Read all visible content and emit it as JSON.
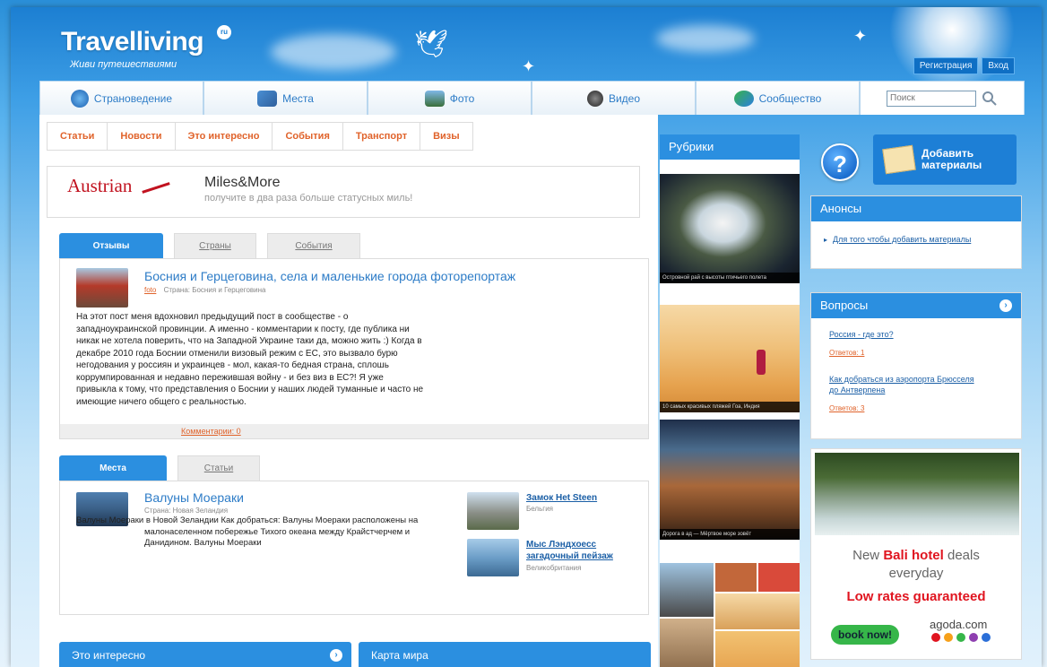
{
  "header": {
    "logo_title": "Travelliving",
    "logo_badge": "ru",
    "logo_subtitle": "Живи путешествиями",
    "register": "Регистрация",
    "login": "Вход"
  },
  "nav": {
    "tabs": [
      {
        "label": "Страноведение",
        "icon": "globe-icon"
      },
      {
        "label": "Места",
        "icon": "map-icon"
      },
      {
        "label": "Фото",
        "icon": "photo-icon"
      },
      {
        "label": "Видео",
        "icon": "film-icon"
      },
      {
        "label": "Сообщество",
        "icon": "community-icon"
      }
    ],
    "search_placeholder": "Поиск"
  },
  "subnav": [
    "Статьи",
    "Новости",
    "Это интересно",
    "События",
    "Транспорт",
    "Визы"
  ],
  "banner": {
    "brand": "Austrian",
    "title": "Miles&More",
    "subtitle": "получите в два раза больше статусных миль!"
  },
  "reviews": {
    "tabs": [
      "Отзывы",
      "Страны",
      "События"
    ],
    "post_title": "Босния и Герцеговина, села и маленькие города фоторепортаж",
    "post_author": "foto",
    "post_country": "Страна: Босния и Герцеговина",
    "post_body": "На этот пост меня вдохновил предыдущий пост в сообществе - о западноукраинской провинции. А именно - комментарии к посту, где публика ни никак не хотела поверить, что на Западной Украине таки да, можно жить :) Когда в декабре 2010 года Боснии отменили визовый режим с ЕС, это вызвало бурю негодования у россиян и украинцев - мол, какая-то бедная страна, сплошь коррумпированная и недавно пережившая войну - и без виз в ЕС?! Я уже привыкла к тому, что представления о Боснии у наших людей туманные и часто не имеющие ничего общего с реальностью.",
    "comments": "Комментарии: 0"
  },
  "places": {
    "tabs": [
      "Места",
      "Статьи"
    ],
    "main_title": "Валуны Моераки",
    "main_country": "Страна: Новая Зеландия",
    "main_body": "Валуны Моераки в Новой Зеландии Как добраться: Валуны Моераки расположены на малонаселенном побережье Тихого океана между Крайстчерчем и Данидином. Валуны Моераки",
    "side": [
      {
        "title": "Замок Het Steen",
        "country": "Бельгия"
      },
      {
        "title": "Мыс Лэндхоесс загадочный пейзаж",
        "country": "Великобритания"
      }
    ]
  },
  "bottom_boxes": [
    "Это интересно",
    "Карта мира"
  ],
  "rubrics": {
    "title": "Рубрики",
    "captions": [
      "Островной рай с высоты птичьего полета",
      "10 самых красивых пляжей Гоа, Индия",
      "Дорога в ад — Мёртвое море зовёт"
    ]
  },
  "add_material": {
    "label_line1": "Добавить",
    "label_line2": "материалы"
  },
  "announces": {
    "title": "Анонсы",
    "items": [
      "Для того чтобы добавить материалы"
    ]
  },
  "questions": {
    "title": "Вопросы",
    "items": [
      {
        "q": "Россия - где это?",
        "a": "Ответов: 1"
      },
      {
        "q": "Как добраться из аэропорта Брюсселя до Антверпена",
        "a": "Ответов: 3"
      }
    ]
  },
  "ad": {
    "line1_pre": "New ",
    "line1_brand": "Bali hotel",
    "line1_post": " deals",
    "line2": "everyday",
    "line3": "Low rates guaranteed",
    "button": "book now!",
    "brand": "agoda.com",
    "dot_colors": [
      "#e0141f",
      "#f6a01a",
      "#36b649",
      "#8e3fb0",
      "#2b6fd8"
    ]
  }
}
